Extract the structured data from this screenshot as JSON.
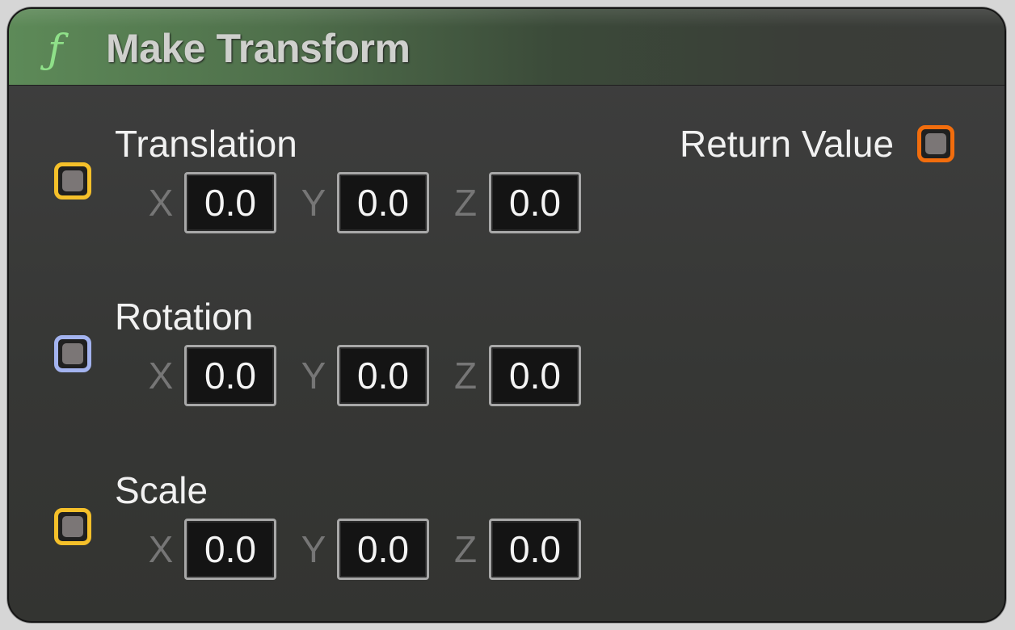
{
  "node": {
    "title": "Make Transform",
    "function_icon_glyph": "ƒ",
    "function_icon_name": "function-icon",
    "header_color": "#5d8a58"
  },
  "inputs": [
    {
      "label": "Translation",
      "pin_color": "#f5c02a",
      "x_label": "X",
      "x_value": "0.0",
      "y_label": "Y",
      "y_value": "0.0",
      "z_label": "Z",
      "z_value": "0.0"
    },
    {
      "label": "Rotation",
      "pin_color": "#a3b3ef",
      "x_label": "X",
      "x_value": "0.0",
      "y_label": "Y",
      "y_value": "0.0",
      "z_label": "Z",
      "z_value": "0.0"
    },
    {
      "label": "Scale",
      "pin_color": "#f5c02a",
      "x_label": "X",
      "x_value": "0.0",
      "y_label": "Y",
      "y_value": "0.0",
      "z_label": "Z",
      "z_value": "0.0"
    }
  ],
  "output": {
    "label": "Return Value",
    "pin_color": "#f26d0d"
  }
}
